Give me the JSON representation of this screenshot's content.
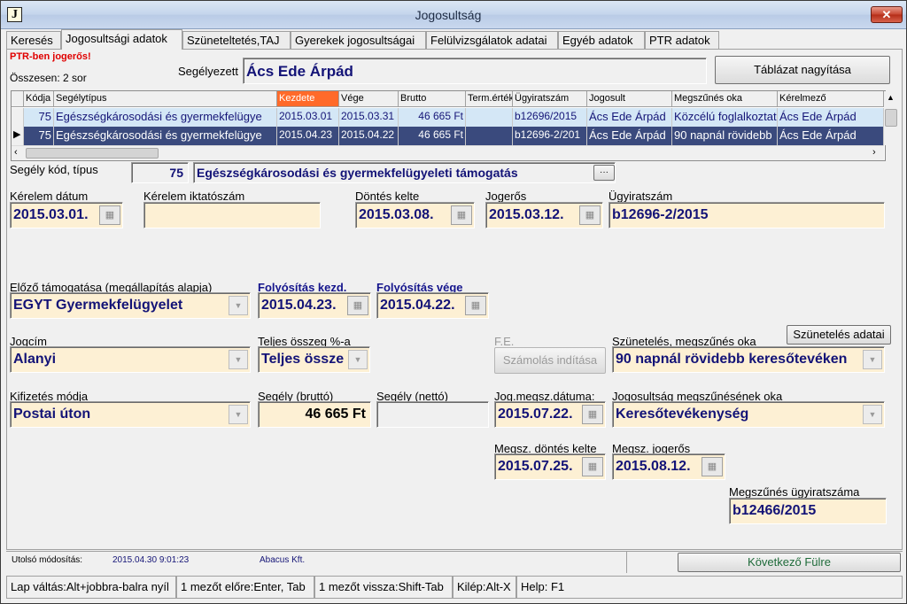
{
  "window": {
    "title": "Jogosultság",
    "icon_letter": "J",
    "close_label": "✕"
  },
  "tabs": [
    {
      "label": "Keresés"
    },
    {
      "label": "Jogosultsági adatok"
    },
    {
      "label": "Szüneteltetés,TAJ"
    },
    {
      "label": "Gyerekek jogosultságai"
    },
    {
      "label": "Felülvizsgálatok adatai"
    },
    {
      "label": "Egyéb adatok"
    },
    {
      "label": "PTR adatok"
    }
  ],
  "header": {
    "ptr_warning": "PTR-ben jogerős!",
    "total_rows": "Összesen: 2 sor",
    "recipient_label": "Segélyezett",
    "recipient_value": "Ács Ede Árpád",
    "enlarge_button": "Táblázat nagyítása"
  },
  "grid": {
    "columns": [
      "Kódja",
      "Segélytípus",
      "Kezdete",
      "Vége",
      "Brutto",
      "Term.érték",
      "Ügyiratszám",
      "Jogosult",
      "Megszűnés oka",
      "Kérelmező"
    ],
    "rows": [
      [
        "75",
        "Egészségkárosodási és gyermekfelügye",
        "2015.03.01",
        "2015.03.31",
        "46 665 Ft",
        "",
        "b12696/2015",
        "Ács Ede Árpád",
        "Közcélú foglalkoztat",
        "Ács Ede Árpád"
      ],
      [
        "75",
        "Egészségkárosodási és gyermekfelügye",
        "2015.04.23",
        "2015.04.22",
        "46 665 Ft",
        "",
        "b12696-2/201",
        "Ács Ede Árpád",
        "90 napnál rövidebb",
        "Ács Ede Árpád"
      ]
    ],
    "row_indicator": "▶"
  },
  "form": {
    "aid_code_label": "Segély kód, típus",
    "aid_code": "75",
    "aid_type": "Egészségkárosodási és gyermekfelügyeleti támogatás",
    "ellipsis": "···",
    "request_date_label": "Kérelem dátum",
    "request_date": "2015.03.01.",
    "request_filing_label": "Kérelem iktatószám",
    "request_filing": "",
    "decision_date_label": "Döntés kelte",
    "decision_date": "2015.03.08.",
    "final_label": "Jogerős",
    "final_date": "2015.03.12.",
    "case_no_label": "Ügyiratszám",
    "case_no": "b12696-2/2015",
    "previous_support_label": "Előző támogatása (megállapítás alapja)",
    "previous_support": "EGYT Gyermekfelügyelet",
    "payment_start_label": "Folyósítás kezd.",
    "payment_start": "2015.04.23.",
    "payment_end_label": "Folyósítás vége",
    "payment_end": "2015.04.22.",
    "legal_title_label": "Jogcím",
    "legal_title": "Alanyi",
    "full_amount_label": "Teljes összeg %-a",
    "full_amount": "Teljes össze",
    "fe_label": "F.E.",
    "calc_button": "Számolás indítása",
    "suspension_label": "Szünetelés, megszűnés oka",
    "suspension_button": "Szünetelés adatai",
    "suspension_reason": "90 napnál rövidebb keresőtevéken",
    "payment_method_label": "Kifizetés módja",
    "payment_method": "Postai úton",
    "gross_label": "Segély (bruttó)",
    "gross": "46 665 Ft",
    "net_label": "Segély (nettó)",
    "net": "",
    "termination_date_label": "Jog.megsz.dátuma:",
    "termination_date": "2015.07.22.",
    "termination_reason_label": "Jogosultság megszűnésének oka",
    "termination_reason": "Keresőtevékenység",
    "termination_decision_label": "Megsz. döntés kelte",
    "termination_decision": "2015.07.25.",
    "termination_final_label": "Megsz. jogerős",
    "termination_final": "2015.08.12.",
    "termination_case_label": "Megszűnés ügyiratszáma",
    "termination_case": "b12466/2015"
  },
  "footer": {
    "last_mod_label": "Utolsó módosítás:",
    "last_mod_time": "2015.04.30 9:01:23",
    "last_mod_by": "Abacus Kft.",
    "next_tab_button": "Következő Fülre"
  },
  "statusbar": [
    "Lap váltás:Alt+jobbra-balra nyíl",
    "1 mezőt előre:Enter, Tab",
    "1 mezőt vissza:Shift-Tab",
    "Kilép:Alt-X",
    "Help: F1"
  ],
  "icons": {
    "calendar": "calendar-icon",
    "dropdown": "chevron-down-icon"
  }
}
